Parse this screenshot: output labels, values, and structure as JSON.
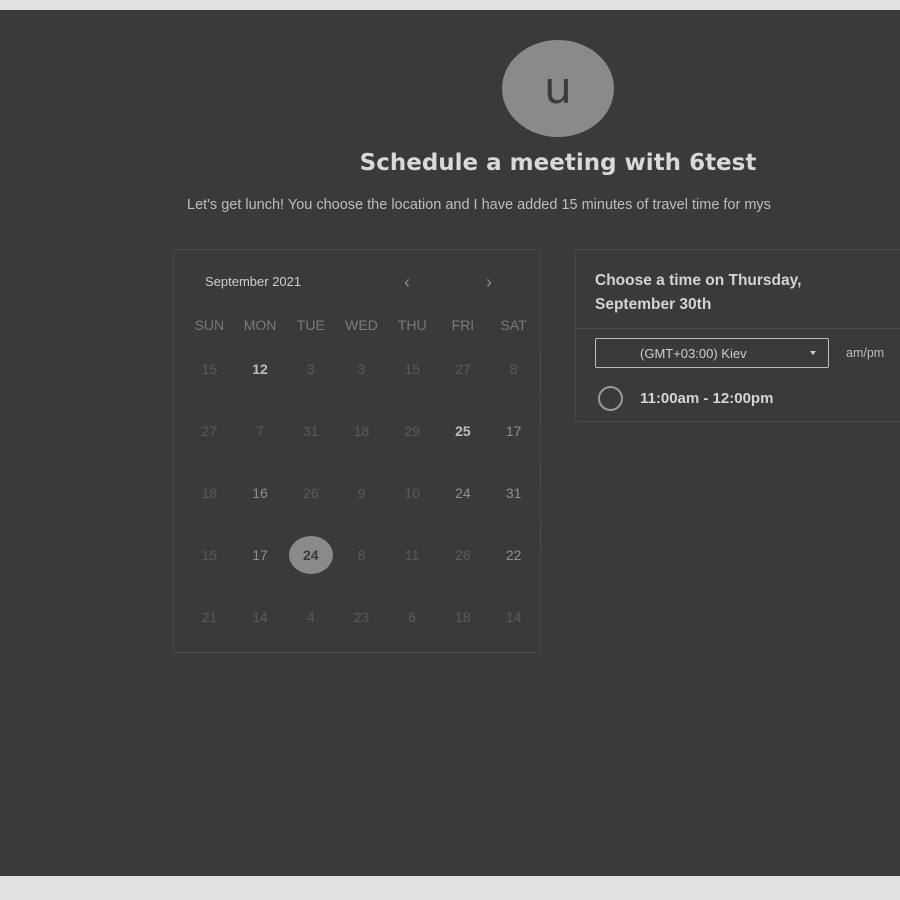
{
  "avatar": {
    "letter": "u"
  },
  "header": {
    "title": "Schedule a meeting with 6test",
    "description": "Let's get lunch! You choose the location and I have added 15 minutes of travel time for mys"
  },
  "calendar": {
    "month_label": "September 2021",
    "prev_icon": "‹",
    "next_icon": "›",
    "weekdays": [
      "SUN",
      "MON",
      "TUE",
      "WED",
      "THU",
      "FRI",
      "SAT"
    ],
    "weeks": [
      [
        "15",
        "12",
        "3",
        "3",
        "15",
        "27",
        "8"
      ],
      [
        "27",
        "7",
        "31",
        "18",
        "29",
        "25",
        "17"
      ],
      [
        "18",
        "16",
        "26",
        "9",
        "10",
        "24",
        "31"
      ],
      [
        "15",
        "17",
        "24",
        "8",
        "11",
        "26",
        "22"
      ],
      [
        "21",
        "14",
        "4",
        "23",
        "6",
        "18",
        "14"
      ]
    ],
    "available": [
      "0-1",
      "1-5"
    ],
    "light": [
      "2-5",
      "2-6",
      "3-6",
      "1-6",
      "2-1",
      "3-1"
    ],
    "selected": "3-2"
  },
  "time_panel": {
    "title": "Choose a time on Thursday, September 30th",
    "timezone": "(GMT+03:00) Kiev",
    "ampm_label": "am/pm",
    "slots": [
      {
        "label": "11:00am - 12:00pm"
      }
    ]
  },
  "colors": {
    "background": "#3a3a3a",
    "page": "#e1e1e1",
    "accent": "#8a8a8a"
  }
}
